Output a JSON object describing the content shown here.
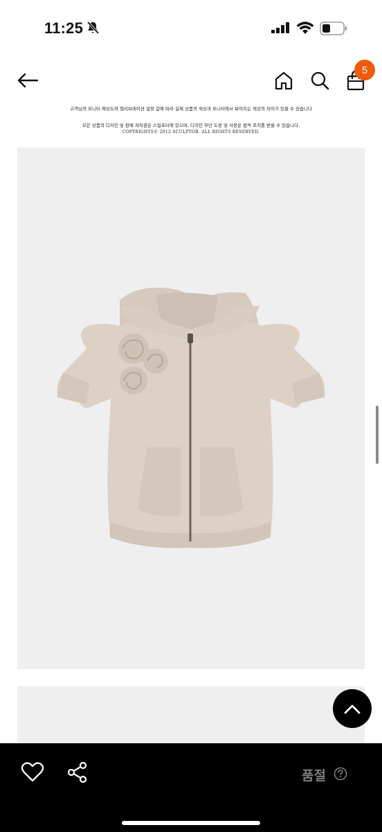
{
  "status_bar": {
    "time": "11:25",
    "icons": [
      "bell-muted-icon",
      "signal-icon",
      "wifi-icon",
      "battery-icon"
    ]
  },
  "header": {
    "icons": [
      "back-arrow-icon",
      "home-icon",
      "search-icon",
      "shopping-bag-icon"
    ],
    "cart_count": "5",
    "badge_color": "#ef5b0c"
  },
  "notice": {
    "line1": "고객님의 모니터 해상도와 캘리브레이션 설정 값에 따라 실제 상품의 색상과 모니터에서 보여지는 색상의 차이가 있을 수 있습니다",
    "line2": "모든 상품의 디자인 및 판매 저작권은 스컬프터에 있으며, 디자인 무단 도용 및 사용은 법적 조치를 받을 수 있습니다.",
    "copyright": "COPYRIGHTS© 2012 SCULPTOR. ALL RIGHTS RESERVED."
  },
  "product": {
    "image": "beige-hooded-zip-up-with-rosettes",
    "garment_color": "#ddd1c6"
  },
  "bottom_bar": {
    "icons": [
      "heart-icon",
      "share-icon",
      "help-icon",
      "chevron-up-icon"
    ],
    "status_label": "품절"
  }
}
